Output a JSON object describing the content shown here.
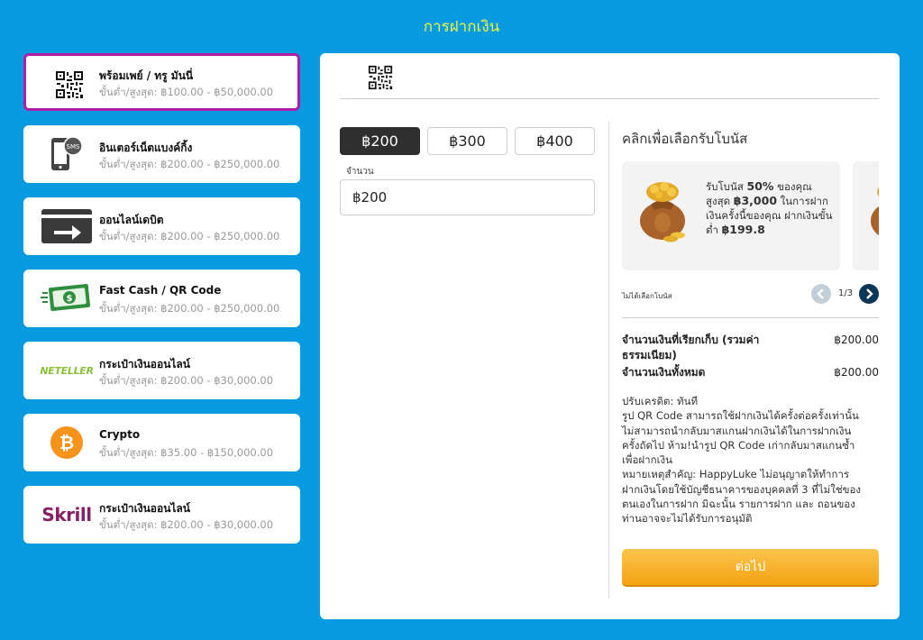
{
  "page": {
    "title": "การฝากเงิน"
  },
  "methods": [
    {
      "name": "พร้อมเพย์ / ทรู มันนี่",
      "range": "ขั้นต่ำ/สูงสุด: ฿100.00 - ฿50,000.00",
      "icon": "qr-code-icon",
      "selected": true
    },
    {
      "name": "อินเตอร์เน็ตแบงค์กิ้ง",
      "range": "ขั้นต่ำ/สูงสุด: ฿200.00 - ฿250,000.00",
      "icon": "sms-phone-icon"
    },
    {
      "name": "ออนไลน์เดบิต",
      "range": "ขั้นต่ำ/สูงสุด: ฿200.00 - ฿250,000.00",
      "icon": "card-arrow-icon"
    },
    {
      "name": "Fast Cash / QR Code",
      "range": "ขั้นต่ำ/สูงสุด: ฿200.00 - ฿250,000.00",
      "icon": "cash-icon"
    },
    {
      "name": "กระเป๋าเงินออนไลน์",
      "range": "ขั้นต่ำ/สูงสุด: ฿200.00 - ฿30,000.00",
      "icon": "neteller-logo",
      "logo_text": "NETELLER"
    },
    {
      "name": "Crypto",
      "range": "ขั้นต่ำ/สูงสุด: ฿35.00 - ฿150,000.00",
      "icon": "bitcoin-icon",
      "logo_text": "₿"
    },
    {
      "name": "กระเป๋าเงินออนไลน์",
      "range": "ขั้นต่ำ/สูงสุด: ฿200.00 - ฿30,000.00",
      "icon": "skrill-logo",
      "logo_text": "Skrill"
    }
  ],
  "panel": {
    "tab_icon": "qr-code-icon"
  },
  "amount": {
    "presets": [
      "฿200",
      "฿300",
      "฿400"
    ],
    "active_preset": "฿200",
    "label": "จำนวน",
    "value": "฿200"
  },
  "bonus": {
    "heading": "คลิกเพื่อเลือกรับโบนัส",
    "card": {
      "icon": "money-bag-icon",
      "pre": "รับโบนัส ",
      "percent": "50%",
      "mid1": " ของคุณ สูงสุด ",
      "max": "฿3,000",
      "mid2": " ในการฝากเงินครั้งนี้ของคุณ ฝากเงินขั้นต่ำ ",
      "min": "฿199.8"
    },
    "no_bonus_label": "ไม่ได้เลือกโบนัส",
    "page_indicator": "1/3"
  },
  "summary": [
    {
      "label": "จำนวนเงินที่เรียกเก็บ (รวมค่าธรรมเนียม)",
      "value": "฿200.00"
    },
    {
      "label": "จำนวนเงินทั้งหมด",
      "value": "฿200.00"
    }
  ],
  "notes": [
    "ปรับเครดิต: ทันที",
    "รูป QR Code สามารถใช้ฝากเงินได้ครั้งต่อครั้งเท่านั้น",
    "ไม่สามารถนำกลับมาสแกนฝากเงินได้ในการฝากเงิน",
    "ครั้งถัดไป ห้าม!นำรูป QR Code เก่ากลับมาสแกนซ้ำ",
    "เพื่อฝากเงิน",
    "หมายเหตุสำคัญ: HappyLuke ไม่อนุญาตให้ทำการ",
    "ฝากเงินโดยใช้บัญชีธนาคารของบุคคลที่ 3 ที่ไม่ใช่ของ",
    "ตนเองในการฝาก มิฉะนั้น รายการฝาก และ ถอนของ",
    "ท่านอาจจะไม่ได้รับการอนุมัติ"
  ],
  "continue_label": "ต่อไป",
  "colors": {
    "background": "#0a9ae0",
    "title": "#e6f542",
    "selected_border": "#b01ca5",
    "button": "#f7a81b"
  }
}
